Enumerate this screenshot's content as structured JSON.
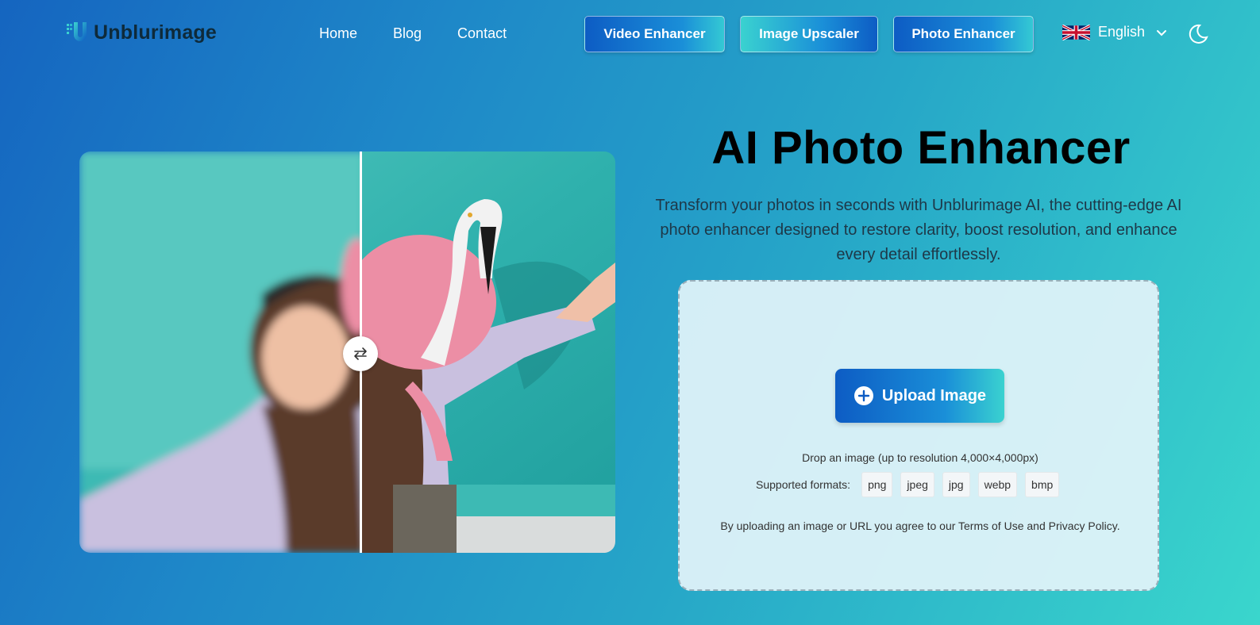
{
  "header": {
    "logo_text": "Unblurimage",
    "nav": [
      "Home",
      "Blog",
      "Contact"
    ],
    "buttons": {
      "video": "Video Enhancer",
      "upscale": "Image Upscaler",
      "photo": "Photo Enhancer"
    },
    "language": "English"
  },
  "hero": {
    "title": "AI Photo Enhancer",
    "subtitle": "Transform your photos in seconds with Unblurimage AI, the cutting-edge AI photo enhancer designed to restore clarity, boost resolution, and enhance every detail effortlessly."
  },
  "upload": {
    "button_label": "Upload Image",
    "drop_text": "Drop an image (up to resolution 4,000×4,000px)",
    "formats_label": "Supported formats:",
    "formats": [
      "png",
      "jpeg",
      "jpg",
      "webp",
      "bmp"
    ],
    "terms": "By uploading an image or URL you agree to our Terms of Use and Privacy Policy."
  },
  "colors": {
    "accent_dark": "#0d5cc4",
    "accent_light": "#3ad2d0",
    "title": "#000000"
  },
  "icons": [
    "logo-icon",
    "uk-flag-icon",
    "chevron-down-icon",
    "moon-icon",
    "swap-arrows-icon",
    "plus-circle-icon"
  ]
}
